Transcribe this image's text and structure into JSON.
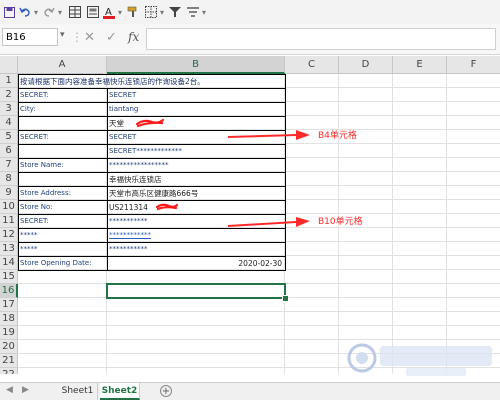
{
  "formula_bar": {
    "name_box": "B16",
    "fx_label": "fx"
  },
  "columns": [
    "A",
    "B",
    "C",
    "D",
    "E",
    "F"
  ],
  "rows": [
    "1",
    "2",
    "3",
    "4",
    "5",
    "6",
    "7",
    "8",
    "9",
    "10",
    "11",
    "12",
    "13",
    "14",
    "15",
    "16",
    "17",
    "18",
    "19",
    "20",
    "21",
    "22"
  ],
  "sheet": {
    "title": "按请根据下面内容准备幸福快乐连锁店的作询设备2台。",
    "r2": {
      "a": "SECRET:",
      "b": "SECRET"
    },
    "r3": {
      "a": "City:",
      "b": "tiantang"
    },
    "r4": {
      "a": "",
      "b": "天堂"
    },
    "r5": {
      "a": "SECRET:",
      "b": "SECRET"
    },
    "r6": {
      "a": "",
      "b": "SECRET*************"
    },
    "r7": {
      "a": "Store Name:",
      "b": "*****************"
    },
    "r8": {
      "a": "",
      "b": "幸福快乐连锁店"
    },
    "r9": {
      "a": "Store Address:",
      "b": "天堂市高乐区健康路666号"
    },
    "r10": {
      "a": "Store No:",
      "b": "US211314"
    },
    "r11": {
      "a": "SECRET:",
      "b": "***********"
    },
    "r12": {
      "a": "*****",
      "b": "************"
    },
    "r13": {
      "a": "*****",
      "b": "***********"
    },
    "r14": {
      "a": "Store Opening Date:",
      "b": "2020-02-30"
    }
  },
  "annotations": {
    "b4": "B4单元格",
    "b10": "B10单元格",
    "color": "#ff2a2a"
  },
  "tabs": {
    "sheet1": "Sheet1",
    "sheet2": "Sheet2",
    "add": "+"
  },
  "accent": "#217346"
}
